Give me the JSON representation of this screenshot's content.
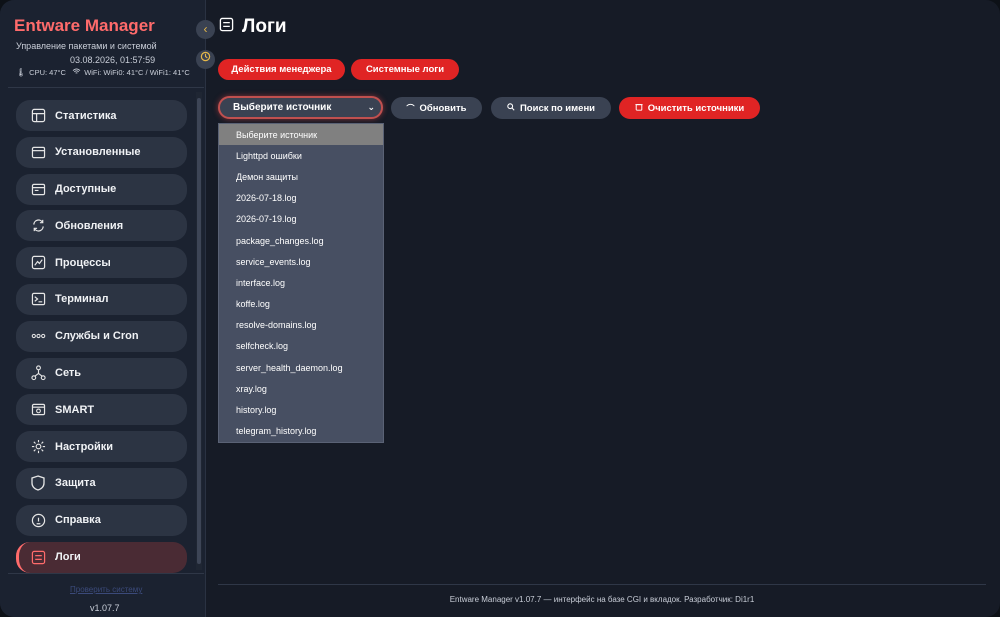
{
  "sidebar": {
    "brand": "Entware Manager",
    "subtitle": "Управление пакетами и системой",
    "datetime": "03.08.2026, 01:57:59",
    "cpu": "CPU: 47°C",
    "wifi": "WiFi: WiFi0: 41°C / WiFi1: 41°C",
    "items": [
      {
        "label": "Статистика",
        "icon": "dashboard-icon"
      },
      {
        "label": "Установленные",
        "icon": "installed-icon"
      },
      {
        "label": "Доступные",
        "icon": "available-icon"
      },
      {
        "label": "Обновления",
        "icon": "refresh-icon"
      },
      {
        "label": "Процессы",
        "icon": "chart-icon"
      },
      {
        "label": "Терминал",
        "icon": "terminal-icon"
      },
      {
        "label": "Службы и Cron",
        "icon": "dots-icon"
      },
      {
        "label": "Сеть",
        "icon": "network-icon"
      },
      {
        "label": "SMART",
        "icon": "disk-icon"
      },
      {
        "label": "Настройки",
        "icon": "gear-icon"
      },
      {
        "label": "Защита",
        "icon": "shield-icon"
      },
      {
        "label": "Справка",
        "icon": "info-icon"
      },
      {
        "label": "Логи",
        "icon": "log-icon"
      }
    ],
    "link": "Проверить систему",
    "version": "v1.07.7"
  },
  "main": {
    "title": "Логи",
    "tabs": [
      "Действия менеджера",
      "Системные логи"
    ],
    "select_value": "Выберите источник",
    "refresh_label": "Обновить",
    "search_label": "Поиск по имени",
    "clear_label": "Очистить источники",
    "options": [
      "Выберите источник",
      "Lighttpd ошибки",
      "Демон защиты",
      "2026-07-18.log",
      "2026-07-19.log",
      "package_changes.log",
      "service_events.log",
      "interface.log",
      "koffe.log",
      "resolve-domains.log",
      "selfcheck.log",
      "server_health_daemon.log",
      "xray.log",
      "history.log",
      "telegram_history.log"
    ]
  },
  "footer": "Entware Manager v1.07.7 — интерфейс на базе CGI и вкладок. Разработчик: Di1r1",
  "colors": {
    "accent": "#e02424",
    "brand": "#ff6b6b",
    "bg": "#161b26"
  }
}
